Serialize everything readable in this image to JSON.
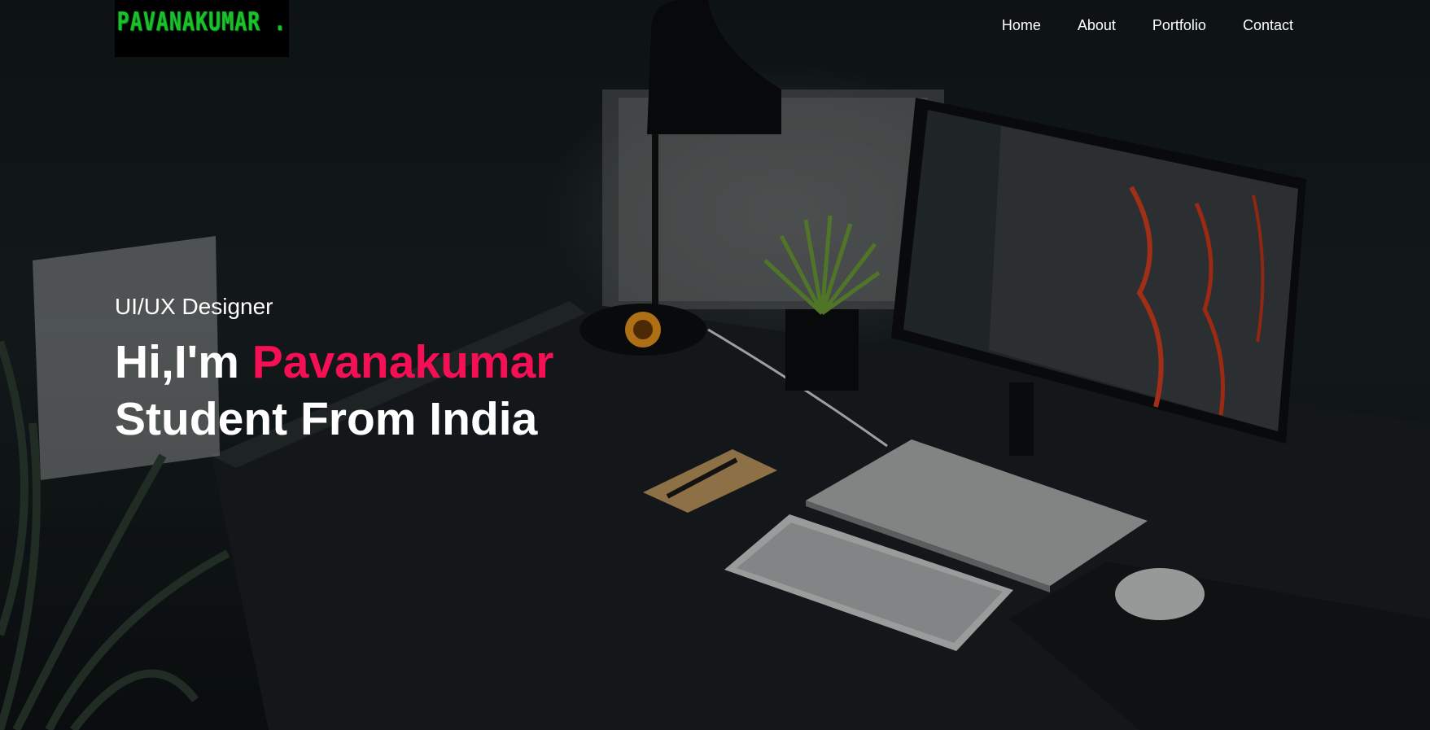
{
  "logo": {
    "text": "PAVANAKUMAR ."
  },
  "nav": {
    "items": [
      {
        "label": "Home"
      },
      {
        "label": "About"
      },
      {
        "label": "Portfolio"
      },
      {
        "label": "Contact"
      }
    ]
  },
  "hero": {
    "subtitle": "UI/UX Designer",
    "greeting": "Hi,I'm",
    "name": "Pavanakumar",
    "tagline": "Student From India",
    "accent_color": "#f50f55"
  },
  "background": {
    "description_icon": "desk-workspace-photo"
  }
}
